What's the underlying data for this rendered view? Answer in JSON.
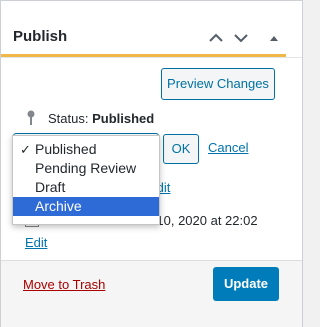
{
  "panel": {
    "title": "Publish",
    "icons": [
      "chevron-up-icon",
      "chevron-down-icon",
      "collapse-triangle-icon"
    ]
  },
  "actions": {
    "preview_label": "Preview Changes",
    "ok_label": "OK",
    "cancel_label": "Cancel",
    "trash_label": "Move to Trash",
    "update_label": "Update"
  },
  "status": {
    "label": "Status:",
    "value": "Published",
    "options": [
      "Published",
      "Pending Review",
      "Draft",
      "Archive"
    ],
    "checked_option": "Published",
    "highlighted_option": "Archive"
  },
  "visibility": {
    "edit_label": "Edit"
  },
  "schedule": {
    "text": "Published on: Mar 10, 2020 at 22:02",
    "edit_label": "Edit"
  },
  "colors": {
    "accent": "#f0b849",
    "primary": "#007cba",
    "link": "#0073aa",
    "danger": "#a00000",
    "highlight": "#2f6bd6"
  }
}
